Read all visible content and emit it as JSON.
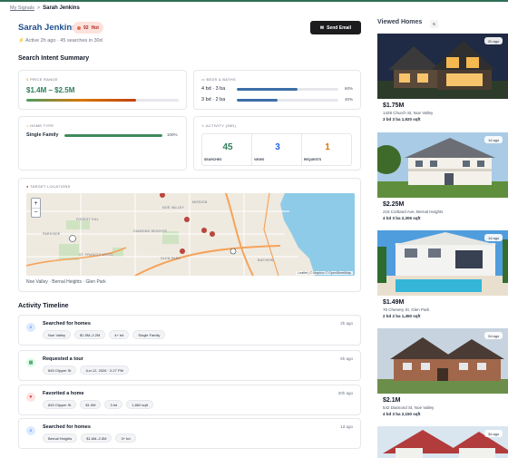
{
  "breadcrumb": {
    "parent": "My Signals",
    "separator": ">",
    "current": "Sarah Jenkins"
  },
  "lead": {
    "name": "Sarah Jenkins",
    "score_badge": "92",
    "status_badge": "Hot",
    "activity_line": "Active 2h ago · 45 searches in 30d",
    "send_email_label": "Send Email"
  },
  "intent": {
    "title": "Search Intent Summary",
    "price_range": {
      "label": "PRICE RANGE",
      "value": "$1.4M – $2.5M",
      "fill": 0.72
    },
    "beds_baths": {
      "label": "BEDS & BATHS",
      "rows": [
        {
          "text": "4 bd · 3 ba",
          "pct": "60%",
          "fill": 0.6
        },
        {
          "text": "3 bd · 2 ba",
          "pct": "40%",
          "fill": 0.4
        }
      ]
    },
    "home_type": {
      "label": "HOME TYPE",
      "value": "Single Family",
      "pct": "100%",
      "fill": 1.0
    },
    "activity": {
      "label": "ACTIVITY (30D)",
      "stats": [
        {
          "value": "45",
          "caption": "SEARCHES",
          "color": "#2f7d5c"
        },
        {
          "value": "3",
          "caption": "VIEWS",
          "color": "#2563eb"
        },
        {
          "value": "1",
          "caption": "REQUESTS",
          "color": "#d97706"
        }
      ]
    },
    "locations": {
      "label": "TARGET LOCATIONS",
      "caption": "Noe Valley · Bernal Heights · Glen Park",
      "map_labels": [
        "FOREST HILL",
        "NOE VALLEY",
        "DIAMOND HEIGHTS",
        "GLEN PARK",
        "BAYVIEW",
        "PARKSIDE",
        "ST. FRANCIS WOOD",
        "MISSION"
      ],
      "attribution": "Leaflet | © Mapbox © OpenStreetMap",
      "zoom_in": "+",
      "zoom_out": "−"
    }
  },
  "timeline": {
    "title": "Activity Timeline",
    "items": [
      {
        "title": "Searched for homes",
        "time": "2h ago",
        "chips": [
          "Noe Valley",
          "$1.5M–2.2M",
          "4+ bd",
          "Single Family"
        ]
      },
      {
        "title": "Requested a tour",
        "time": "5h ago",
        "chips": [
          "845 Clipper St",
          "Jun 12, 2026 · 2:27 PM"
        ]
      },
      {
        "title": "Favorited a home",
        "time": "20h ago",
        "chips": [
          "845 Clipper St",
          "$1.9M",
          "3 bd",
          "1,860 sqft"
        ]
      },
      {
        "title": "Searched for homes",
        "time": "1d ago",
        "chips": [
          "Bernal Heights",
          "$1.6M–2.5M",
          "3+ bd"
        ]
      }
    ]
  },
  "viewed": {
    "title": "Viewed Homes",
    "count": "5",
    "homes": [
      {
        "ago": "2h ago",
        "price": "$1.75M",
        "address": "1429 Church St, Noe Valley",
        "specs": "3 bd  3 ba  1,920 sqft"
      },
      {
        "ago": "1d ago",
        "price": "$2.25M",
        "address": "218 Cortland Ave, Bernal Heights",
        "specs": "4 bd  3 ba  2,306 sqft"
      },
      {
        "ago": "1d ago",
        "price": "$1.49M",
        "address": "76 Chenery St, Glen Park",
        "specs": "2 bd  2 ba  1,450 sqft"
      },
      {
        "ago": "2d ago",
        "price": "$2.1M",
        "address": "542 Diamond St, Noe Valley",
        "specs": "4 bd  3 ba  2,150 sqft"
      },
      {
        "ago": "3d ago",
        "price": "",
        "address": "",
        "specs": ""
      }
    ]
  },
  "colors": {
    "name_blue": "#1e4f8f",
    "hot_bg": "#fde2dc",
    "bar_blue": "#3b6ea8",
    "bar_green": "#3f8a5c"
  }
}
